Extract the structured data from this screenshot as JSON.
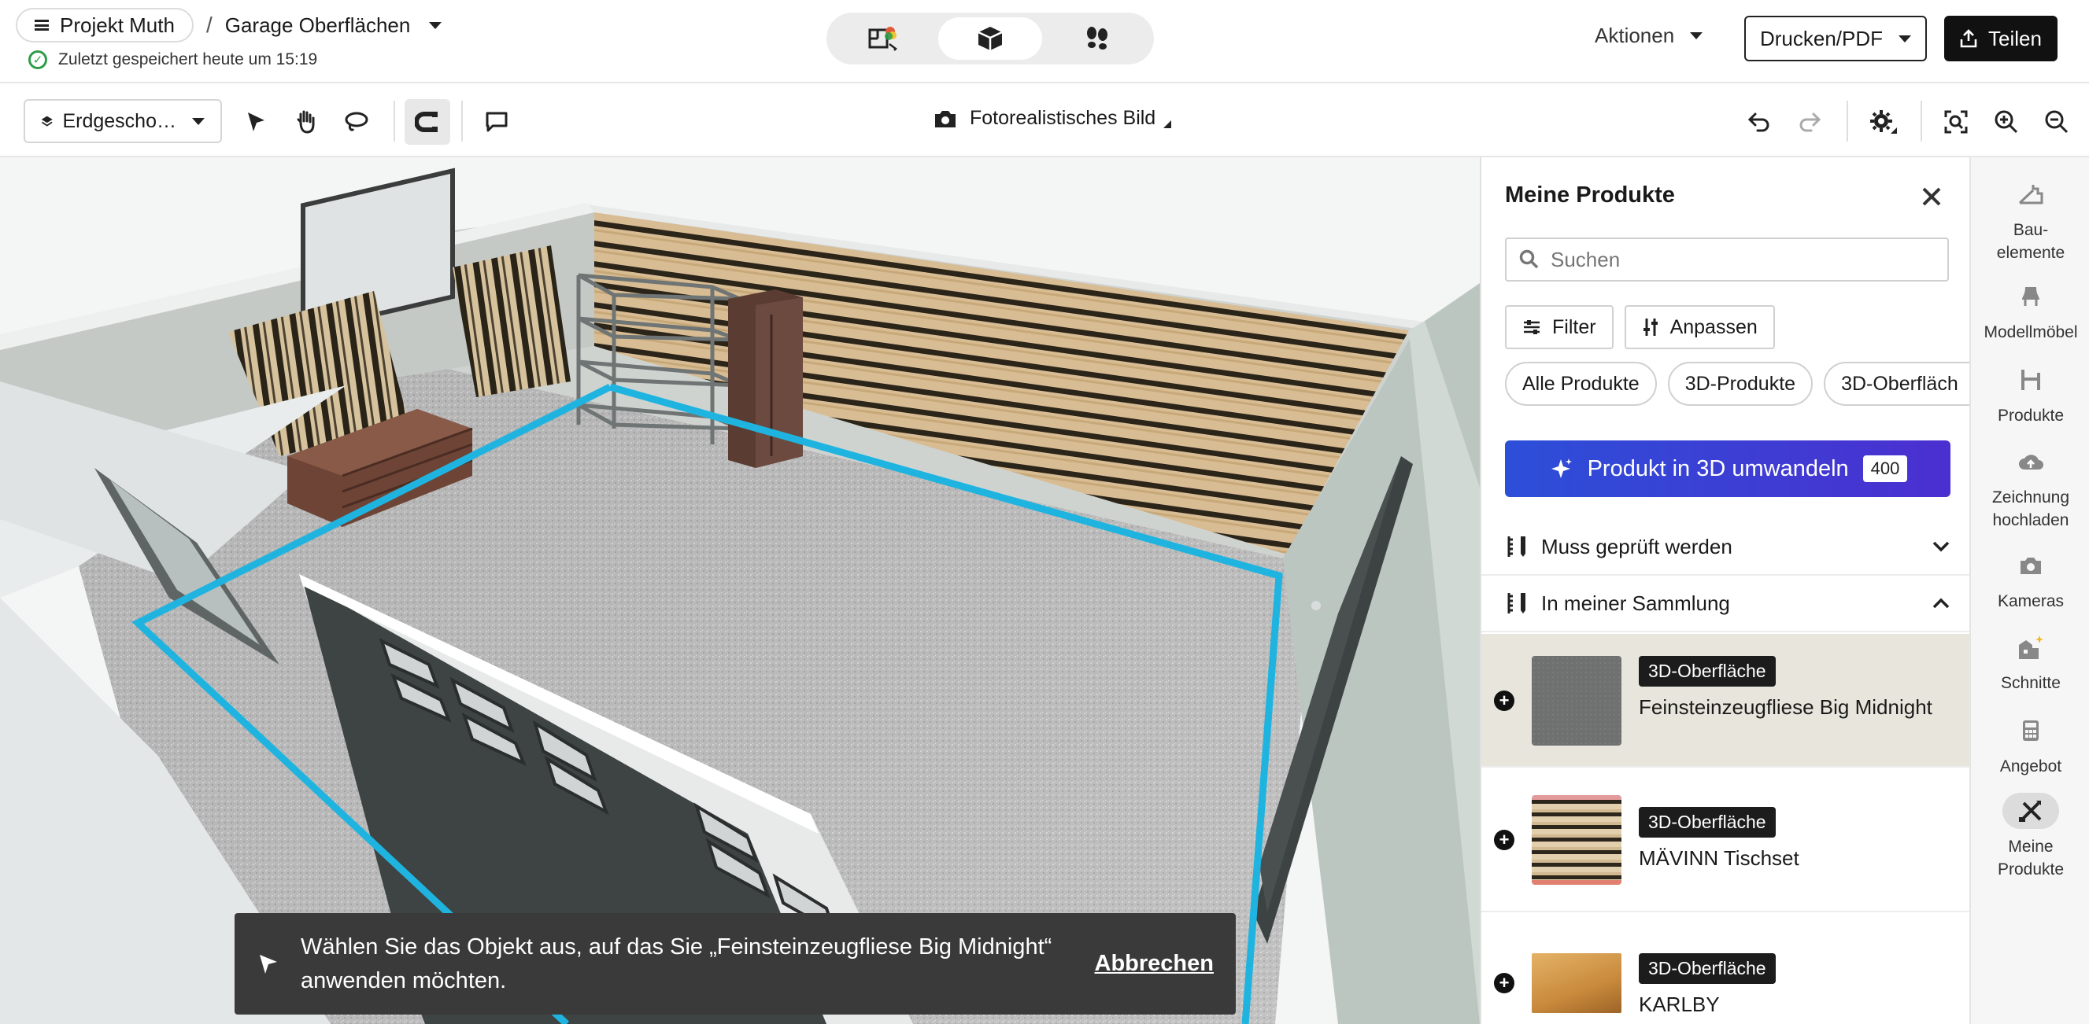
{
  "header": {
    "project": "Projekt Muth",
    "separator": "/",
    "plan_name": "Garage Oberflächen",
    "saved_status": "Zuletzt gespeichert heute um 15:19",
    "actions_label": "Aktionen",
    "print_label": "Drucken/PDF",
    "share_label": "Teilen"
  },
  "toolbar": {
    "floor_label": "Erdgescho…",
    "photo_label": "Fotorealistisches Bild"
  },
  "panel": {
    "title": "Meine Produkte",
    "search_placeholder": "Suchen",
    "filter_label": "Filter",
    "adjust_label": "Anpassen",
    "tabs": [
      "Alle Produkte",
      "3D-Produkte",
      "3D-Oberfläch"
    ],
    "convert_label": "Produkt in 3D umwandeln",
    "convert_count": "400",
    "sections": [
      {
        "label": "Muss geprüft werden",
        "expanded": false
      },
      {
        "label": "In meiner Sammlung",
        "expanded": true
      }
    ],
    "products": [
      {
        "tag": "3D-Oberfläche",
        "name": "Feinsteinzeugfliese Big Midnight",
        "selected": true
      },
      {
        "tag": "3D-Oberfläche",
        "name": "MÄVINN Tischset",
        "selected": false
      },
      {
        "tag": "3D-Oberfläche",
        "name": "KARLBY",
        "selected": false
      }
    ]
  },
  "rail": {
    "items": [
      {
        "label": "Bau-\nelemente",
        "icon": "building-elements-icon"
      },
      {
        "label": "Modellmöbel",
        "icon": "model-furniture-icon"
      },
      {
        "label": "Produkte",
        "icon": "products-icon"
      },
      {
        "label": "Zeichnung\nhochladen",
        "icon": "upload-cloud-icon"
      },
      {
        "label": "Kameras",
        "icon": "camera-icon"
      },
      {
        "label": "Schnitte",
        "icon": "sections-icon"
      },
      {
        "label": "Angebot",
        "icon": "calculator-icon"
      },
      {
        "label": "Meine\nProdukte",
        "icon": "my-products-icon",
        "active": true
      }
    ]
  },
  "toast": {
    "message": "Wählen Sie das Objekt aus, auf das Sie „Feinsteinzeugfliese Big Midnight“ anwenden möchten.",
    "cancel_label": "Abbrechen"
  },
  "colors": {
    "selection_outline": "#1fb4e0",
    "convert_gradient_start": "#2c4fd8",
    "convert_gradient_end": "#4b2fd0",
    "saved_check": "#2e9d4a",
    "selected_row": "#e8e6dc"
  }
}
